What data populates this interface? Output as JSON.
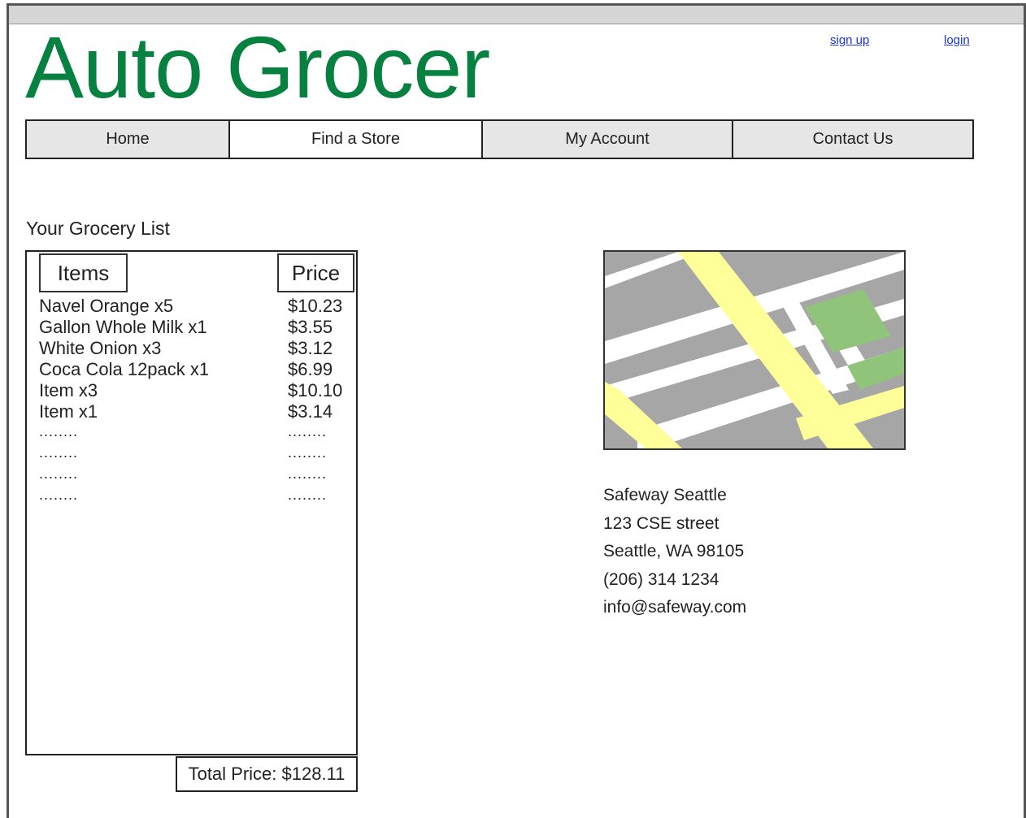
{
  "header": {
    "logo": "Auto Grocer",
    "logo_color": "#068140",
    "sign_up": "sign up",
    "login": "login",
    "link_color": "#1a33e0"
  },
  "nav": {
    "items": [
      {
        "label": "Home"
      },
      {
        "label": "Find a Store"
      },
      {
        "label": "My Account"
      },
      {
        "label": "Contact Us"
      }
    ]
  },
  "grocery": {
    "title": "Your Grocery List",
    "col_items": "Items",
    "col_price": "Price",
    "rows": [
      {
        "item": "Navel Orange x5",
        "price": "$10.23"
      },
      {
        "item": "Gallon Whole Milk x1",
        "price": "$3.55"
      },
      {
        "item": "White Onion x3",
        "price": "$3.12"
      },
      {
        "item": "Coca Cola 12pack x1",
        "price": "$6.99"
      },
      {
        "item": "Item x3",
        "price": "$10.10"
      },
      {
        "item": "Item x1",
        "price": "$3.14"
      },
      {
        "item": "........",
        "price": "........"
      },
      {
        "item": "........",
        "price": "........"
      },
      {
        "item": "........",
        "price": "........"
      },
      {
        "item": "........",
        "price": "........"
      }
    ],
    "total": "Total Price: $128.11"
  },
  "store": {
    "name": "Safeway Seattle",
    "street": "123 CSE street",
    "city": "Seattle, WA 98105",
    "phone": "(206) 314 1234",
    "email": "info@safeway.com"
  },
  "map": {
    "icon": "map-image",
    "colors": {
      "block": "#a6a6a6",
      "road": "#ffffff",
      "highway": "#ffff99",
      "park": "#8fc47a"
    }
  }
}
